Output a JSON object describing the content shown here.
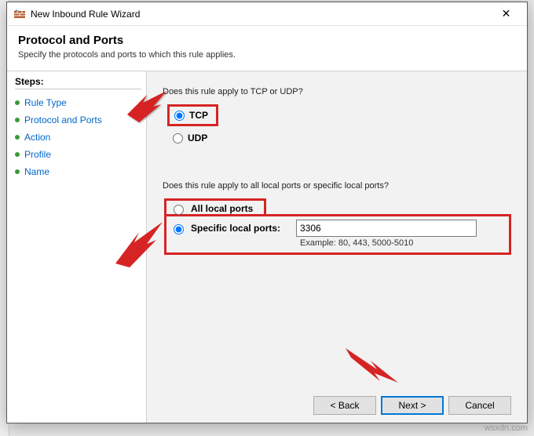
{
  "window": {
    "title": "New Inbound Rule Wizard",
    "close_glyph": "✕"
  },
  "header": {
    "page_title": "Protocol and Ports",
    "subtitle": "Specify the protocols and ports to which this rule applies."
  },
  "steps": {
    "label": "Steps:",
    "items": [
      {
        "label": "Rule Type"
      },
      {
        "label": "Protocol and Ports"
      },
      {
        "label": "Action"
      },
      {
        "label": "Profile"
      },
      {
        "label": "Name"
      }
    ]
  },
  "content": {
    "question_protocol": "Does this rule apply to TCP or UDP?",
    "tcp_label": "TCP",
    "udp_label": "UDP",
    "question_ports": "Does this rule apply to all local ports or specific local ports?",
    "all_local_ports_label": "All local ports",
    "specific_label": "Specific local ports:",
    "port_value": "3306",
    "example": "Example: 80, 443, 5000-5010"
  },
  "footer": {
    "back": "< Back",
    "next": "Next >",
    "cancel": "Cancel"
  },
  "watermark": "wsxdn.com",
  "colors": {
    "highlight_red": "#d62424",
    "link_blue": "#0066cc",
    "primary_border": "#0078d7"
  }
}
